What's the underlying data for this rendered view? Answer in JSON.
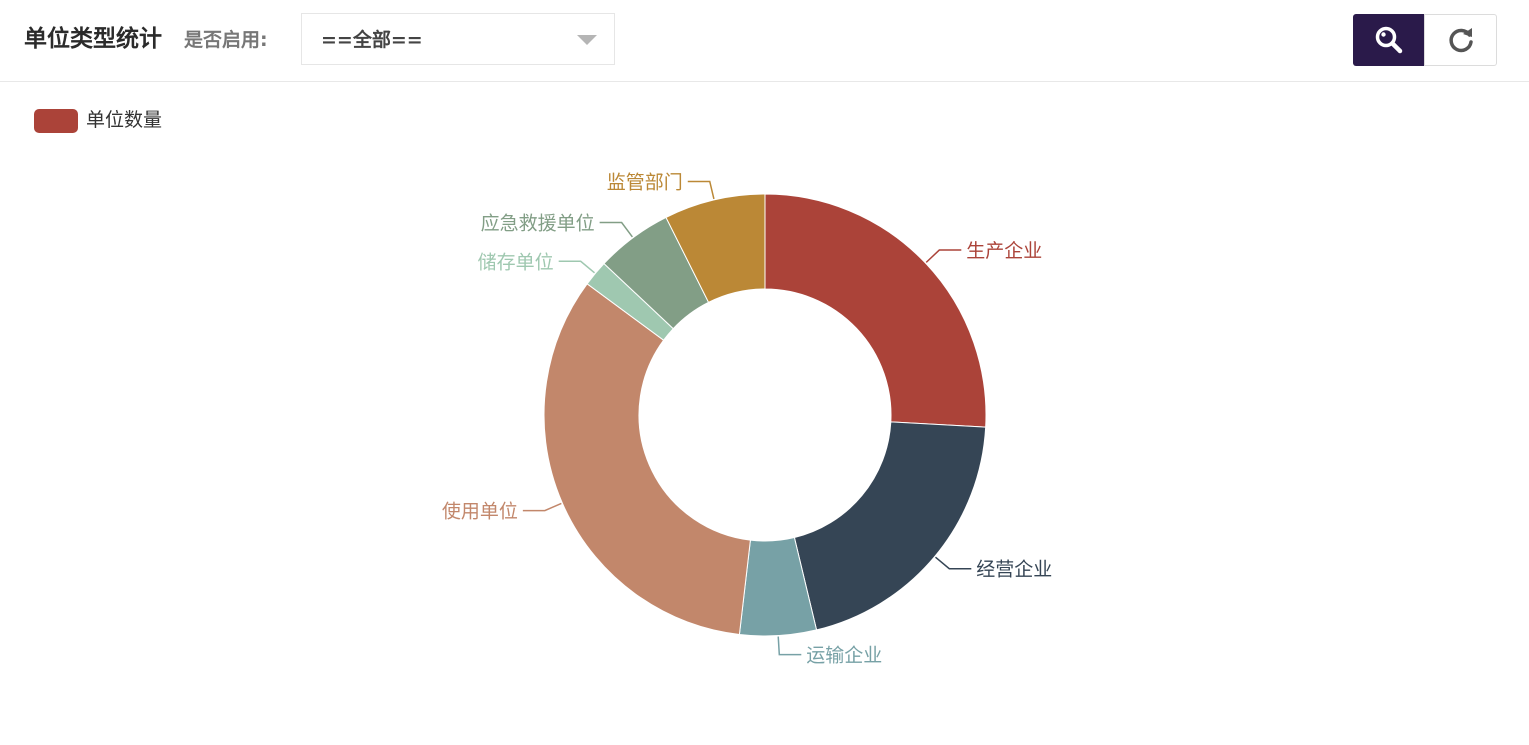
{
  "header": {
    "title": "单位类型统计",
    "filter_label": "是否启用:",
    "filter_value": "==全部=="
  },
  "toolbar": {
    "search_icon": "search-icon",
    "refresh_icon": "refresh-icon"
  },
  "legend": {
    "label": "单位数量",
    "color": "#ab4339"
  },
  "chart_data": {
    "type": "pie",
    "variant": "donut",
    "legend": [
      "单位数量"
    ],
    "legend_position": "top-left",
    "series": [
      {
        "name": "单位数量",
        "slices": [
          {
            "label": "生产企业",
            "percent": 25.9,
            "color": "#ab4339"
          },
          {
            "label": "经营企业",
            "percent": 20.4,
            "color": "#354555"
          },
          {
            "label": "运输企业",
            "percent": 5.6,
            "color": "#77a1a6"
          },
          {
            "label": "使用单位",
            "percent": 33.3,
            "color": "#c2876b"
          },
          {
            "label": "储存单位",
            "percent": 1.9,
            "color": "#9fc8b0"
          },
          {
            "label": "应急救援单位",
            "percent": 5.6,
            "color": "#829e86"
          },
          {
            "label": "监管部门",
            "percent": 7.4,
            "color": "#bb8836"
          }
        ]
      }
    ]
  }
}
